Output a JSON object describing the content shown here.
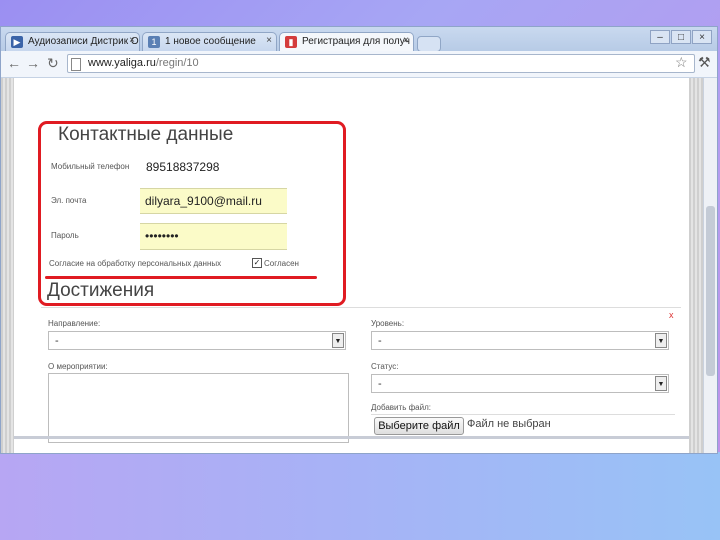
{
  "browser": {
    "tabs": [
      {
        "label": "Аудиозаписи Дистрик О",
        "icon": "video-play-icon",
        "color": "#3a63a8"
      },
      {
        "label": "1 новое сообщение",
        "icon": "mail-icon",
        "color": "#5a7fb4"
      },
      {
        "label": "Регистрация для получ",
        "icon": "page-icon",
        "color": "#d43c3c"
      }
    ],
    "tab_close": "×",
    "window_buttons": [
      "–",
      "□",
      "×"
    ],
    "url_host": "www.yaliga.ru",
    "url_path": "/regin/10"
  },
  "contacts": {
    "heading": "Контактные данные",
    "phone_label": "Мобильный телефон",
    "phone_value": "89518837298",
    "email_label": "Эл. почта",
    "email_value": "dilyara_9100@mail.ru",
    "password_label": "Пароль",
    "password_value": "••••••••",
    "consent_label": "Согласие на обработку персональных данных",
    "consent_checked": true,
    "consent_text": "Согласен"
  },
  "achievements": {
    "heading": "Достижения",
    "close_mark": "x",
    "direction_label": "Направление:",
    "direction_value": "-",
    "level_label": "Уровень:",
    "level_value": "-",
    "event_label": "О мероприятии:",
    "status_label": "Статус:",
    "status_value": "-",
    "add_file_label": "Добавить файл:",
    "file_button": "Выберите файл",
    "file_status": "Файл не выбран"
  },
  "colors": {
    "highlight": "#e01b22",
    "field_bg": "#fbfbc8"
  }
}
